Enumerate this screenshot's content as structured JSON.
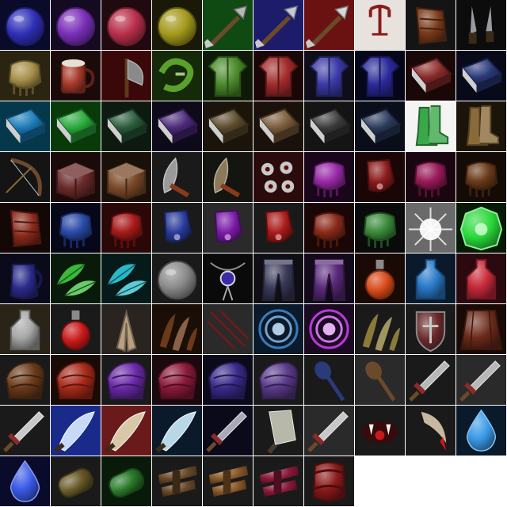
{
  "sheet": {
    "columns": 10,
    "icons": [
      {
        "icon": "blue-orb-icon",
        "shape": "orb",
        "color": "#2f2fb8",
        "bg": "#0a0a2a"
      },
      {
        "icon": "purple-orb-icon",
        "shape": "orb",
        "color": "#7a2fb8",
        "bg": "#140a22"
      },
      {
        "icon": "red-orb-icon",
        "shape": "orb",
        "color": "#b82f4a",
        "bg": "#200a10"
      },
      {
        "icon": "yellow-orb-icon",
        "shape": "orb",
        "color": "#a49a1c",
        "bg": "#1a1806"
      },
      {
        "icon": "poison-arrow-icon",
        "shape": "arrow",
        "color": "#b8b8b8",
        "bg": "#0e4a12"
      },
      {
        "icon": "frost-arrow-icon",
        "shape": "arrow",
        "color": "#c8c8d8",
        "bg": "#1c1c6a"
      },
      {
        "icon": "fire-arrow-icon",
        "shape": "arrow",
        "color": "#d8d8d8",
        "bg": "#6a1212"
      },
      {
        "icon": "grappling-hook-icon",
        "shape": "hook",
        "color": "#8a1a1a",
        "bg": "#e8e2dc"
      },
      {
        "icon": "leather-bracer-icon",
        "shape": "bracer",
        "color": "#7a3a1a",
        "bg": "#141414"
      },
      {
        "icon": "throwing-knives-icon",
        "shape": "blades",
        "color": "#9a9aa0",
        "bg": "#0c0c0c"
      },
      {
        "icon": "gold-gauntlet-icon",
        "shape": "gauntlet",
        "color": "#a8904a",
        "bg": "#2a2410"
      },
      {
        "icon": "ale-mug-icon",
        "shape": "mug",
        "color": "#a83a2a",
        "bg": "#1a0a0a"
      },
      {
        "icon": "war-axe-icon",
        "shape": "axe",
        "color": "#8a8a8a",
        "bg": "#3a0808"
      },
      {
        "icon": "green-sigil-icon",
        "shape": "sigil",
        "color": "#5aa02a",
        "bg": "#142a08"
      },
      {
        "icon": "green-tunic-icon",
        "shape": "tunic",
        "color": "#4a8a2a",
        "bg": "#0e1a08"
      },
      {
        "icon": "red-chest-armor-icon",
        "shape": "tunic",
        "color": "#a02a2a",
        "bg": "#1a0606"
      },
      {
        "icon": "plate-pauldron-icon",
        "shape": "tunic",
        "color": "#3a3aa8",
        "bg": "#0e0e1a"
      },
      {
        "icon": "arcane-robe-icon",
        "shape": "tunic",
        "color": "#2a2a9a",
        "bg": "#06061a"
      },
      {
        "icon": "red-tome-icon",
        "shape": "book",
        "color": "#8a2a2a",
        "bg": "#1a0808"
      },
      {
        "icon": "blue-tome-icon",
        "shape": "book",
        "color": "#2a3a7a",
        "bg": "#080a1a"
      },
      {
        "icon": "glowing-blue-tome-icon",
        "shape": "book",
        "color": "#1a7ab8",
        "bg": "#04384a"
      },
      {
        "icon": "glowing-green-tome-icon",
        "shape": "book",
        "color": "#2aa83a",
        "bg": "#083a0a"
      },
      {
        "icon": "green-spellbook-icon",
        "shape": "book",
        "color": "#2a5a3a",
        "bg": "#0c1a10"
      },
      {
        "icon": "purple-spellbook-icon",
        "shape": "book",
        "color": "#4a2a7a",
        "bg": "#0e0a1a"
      },
      {
        "icon": "olive-spellbook-icon",
        "shape": "book",
        "color": "#5a4a2a",
        "bg": "#1a140a"
      },
      {
        "icon": "wooden-book-icon",
        "shape": "book",
        "color": "#7a5a3a",
        "bg": "#1a120a"
      },
      {
        "icon": "black-book-icon",
        "shape": "book",
        "color": "#3a3a3a",
        "bg": "#141414"
      },
      {
        "icon": "navy-book-icon",
        "shape": "book",
        "color": "#2a3a5a",
        "bg": "#0a0e1a"
      },
      {
        "icon": "green-boots-icon",
        "shape": "boots",
        "color": "#3aa84a",
        "bg": "#f4f4f4"
      },
      {
        "icon": "leather-boots-icon",
        "shape": "boots",
        "color": "#8a6a3a",
        "bg": "#1a140a"
      },
      {
        "icon": "longbow-icon",
        "shape": "bow",
        "color": "#6a4a2a",
        "bg": "#141414"
      },
      {
        "icon": "red-chest-icon",
        "shape": "chest",
        "color": "#6a2a2a",
        "bg": "#1a0a0a"
      },
      {
        "icon": "wooden-chest-icon",
        "shape": "chest",
        "color": "#7a4a2a",
        "bg": "#1a100a"
      },
      {
        "icon": "curved-dagger-icon",
        "shape": "dagger",
        "color": "#9a9a9a",
        "bg": "#1a1a1a"
      },
      {
        "icon": "bronze-dagger-icon",
        "shape": "dagger",
        "color": "#8a7a5a",
        "bg": "#141410"
      },
      {
        "icon": "eyeballs-icon",
        "shape": "eyes",
        "color": "#c8c8c8",
        "bg": "#2a0a0a"
      },
      {
        "icon": "violet-gauntlet-icon",
        "shape": "gauntlet",
        "color": "#9a2aa8",
        "bg": "#1a061a"
      },
      {
        "icon": "crimson-glove-icon",
        "shape": "glove",
        "color": "#8a1a1a",
        "bg": "#1a0606"
      },
      {
        "icon": "magenta-gauntlet-icon",
        "shape": "gauntlet",
        "color": "#9a1a5a",
        "bg": "#1a0610"
      },
      {
        "icon": "brown-gauntlet-icon",
        "shape": "gauntlet",
        "color": "#6a3a1a",
        "bg": "#140a06"
      },
      {
        "icon": "ruby-bracer-icon",
        "shape": "bracer",
        "color": "#8a2a1a",
        "bg": "#140806"
      },
      {
        "icon": "sapphire-gauntlet-icon",
        "shape": "gauntlet",
        "color": "#2a4aa8",
        "bg": "#06081a"
      },
      {
        "icon": "red-striped-gauntlet-icon",
        "shape": "gauntlet",
        "color": "#a81a1a",
        "bg": "#2a0808"
      },
      {
        "icon": "steel-blue-glove-icon",
        "shape": "glove",
        "color": "#2a3a9a",
        "bg": "#1a1a1a"
      },
      {
        "icon": "violet-glove-icon",
        "shape": "glove",
        "color": "#7a1aa8",
        "bg": "#2a2a2a"
      },
      {
        "icon": "red-glove-icon",
        "shape": "glove",
        "color": "#a81a1a",
        "bg": "#1a1a1a"
      },
      {
        "icon": "flame-gauntlet-icon",
        "shape": "gauntlet",
        "color": "#8a2a1a",
        "bg": "#1a0606"
      },
      {
        "icon": "emerald-gauntlet-icon",
        "shape": "gauntlet",
        "color": "#3a8a3a",
        "bg": "#0a0a0a"
      },
      {
        "icon": "holy-light-icon",
        "shape": "burst",
        "color": "#f4f4f4",
        "bg": "#6a6a6a"
      },
      {
        "icon": "green-gem-icon",
        "shape": "gem",
        "color": "#2ad83a",
        "bg": "#061a06"
      },
      {
        "icon": "blue-pitcher-icon",
        "shape": "jug",
        "color": "#2a2a8a",
        "bg": "#0a0a1a"
      },
      {
        "icon": "green-leaves-icon",
        "shape": "leaves",
        "color": "#3ab83a",
        "bg": "#0a1a0a"
      },
      {
        "icon": "cyan-leaves-icon",
        "shape": "leaves",
        "color": "#2ab8c8",
        "bg": "#061a1a"
      },
      {
        "icon": "moon-stone-icon",
        "shape": "orb",
        "color": "#8a8a8a",
        "bg": "#1a1a1a"
      },
      {
        "icon": "amulet-icon",
        "shape": "amulet",
        "color": "#3a2aa8",
        "bg": "#0a0a0a"
      },
      {
        "icon": "dark-leggings-icon",
        "shape": "pants",
        "color": "#3a3a5a",
        "bg": "#0e0e14"
      },
      {
        "icon": "purple-leggings-icon",
        "shape": "pants",
        "color": "#5a2a7a",
        "bg": "#120a1a"
      },
      {
        "icon": "fire-potion-icon",
        "shape": "potion",
        "color": "#d84a1a",
        "bg": "#1a0a06"
      },
      {
        "icon": "blue-bottle-icon",
        "shape": "bottle",
        "color": "#2a7ac8",
        "bg": "#0a1a2a"
      },
      {
        "icon": "red-bottle-icon",
        "shape": "bottle",
        "color": "#c82a3a",
        "bg": "#2a0a0e"
      },
      {
        "icon": "silver-flask-icon",
        "shape": "bottle",
        "color": "#a8a8a8",
        "bg": "#2a2418"
      },
      {
        "icon": "red-potion-icon",
        "shape": "potion",
        "color": "#c81a1a",
        "bg": "#1a1a1a"
      },
      {
        "icon": "praying-hands-icon",
        "shape": "hands",
        "color": "#b8a080",
        "bg": "#2a2420"
      },
      {
        "icon": "claws-icon",
        "shape": "claw",
        "color": "#6a3a1a",
        "bg": "#1a0e06"
      },
      {
        "icon": "slash-marks-icon",
        "shape": "slash",
        "color": "#6a1a1a",
        "bg": "#2a2a2a"
      },
      {
        "icon": "vortex-icon",
        "shape": "vortex",
        "color": "#3a7ab8",
        "bg": "#0a1a2a"
      },
      {
        "icon": "purple-vortex-icon",
        "shape": "vortex",
        "color": "#b83ad8",
        "bg": "#1a0a22"
      },
      {
        "icon": "spiked-jaw-icon",
        "shape": "claw",
        "color": "#8a7a3a",
        "bg": "#1a1a1a"
      },
      {
        "icon": "shield-icon",
        "shape": "shield",
        "color": "#6a2a2a",
        "bg": "#1a1a1a"
      },
      {
        "icon": "leather-cloak-icon",
        "shape": "cloak",
        "color": "#6a2a1a",
        "bg": "#1a0a06"
      },
      {
        "icon": "leather-shoulder-icon",
        "shape": "shoulder",
        "color": "#6a3a1a",
        "bg": "#1a1a1a"
      },
      {
        "icon": "red-shoulder-icon",
        "shape": "shoulder",
        "color": "#a82a1a",
        "bg": "#1a0a06"
      },
      {
        "icon": "purple-shoulder-icon",
        "shape": "shoulder",
        "color": "#6a2aa8",
        "bg": "#1a1a1a"
      },
      {
        "icon": "crimson-shoulder-icon",
        "shape": "shoulder",
        "color": "#8a1a3a",
        "bg": "#1a0a0e"
      },
      {
        "icon": "indigo-shoulder-icon",
        "shape": "shoulder",
        "color": "#3a2a8a",
        "bg": "#0a0a1a"
      },
      {
        "icon": "violet-shoulder-icon",
        "shape": "shoulder",
        "color": "#5a3a8a",
        "bg": "#1a1a1a"
      },
      {
        "icon": "blue-spoon-icon",
        "shape": "spoon",
        "color": "#2a3a7a",
        "bg": "#1a1a1a"
      },
      {
        "icon": "wooden-spoon-icon",
        "shape": "spoon",
        "color": "#6a4a2a",
        "bg": "#2a2a2a"
      },
      {
        "icon": "steel-sword-icon",
        "shape": "sword",
        "color": "#b8b8b8",
        "bg": "#1a1a1a"
      },
      {
        "icon": "red-hilt-sword-icon",
        "shape": "sword",
        "color": "#b8b8b8",
        "bg": "#2a2a2a"
      },
      {
        "icon": "broadsword-icon",
        "shape": "sword",
        "color": "#c8c8c8",
        "bg": "#1a1a1a"
      },
      {
        "icon": "lightning-blade-icon",
        "shape": "blade",
        "color": "#c8d8f8",
        "bg": "#1a2a8a"
      },
      {
        "icon": "flame-blade-icon",
        "shape": "blade",
        "color": "#d8c8a8",
        "bg": "#6a1a1a"
      },
      {
        "icon": "ice-dagger-icon",
        "shape": "blade",
        "color": "#b8d8e8",
        "bg": "#0a1a2a"
      },
      {
        "icon": "ornate-sword-icon",
        "shape": "sword",
        "color": "#a8a8b8",
        "bg": "#0a0a1a"
      },
      {
        "icon": "cleaver-icon",
        "shape": "cleaver",
        "color": "#b8b8a8",
        "bg": "#1a1a1a"
      },
      {
        "icon": "short-sword-icon",
        "shape": "sword",
        "color": "#c8c8c8",
        "bg": "#2a2a2a"
      },
      {
        "icon": "fanged-mouth-icon",
        "shape": "fangs",
        "color": "#c81a1a",
        "bg": "#1a1a1a"
      },
      {
        "icon": "bloody-fang-icon",
        "shape": "fang",
        "color": "#c8b8a0",
        "bg": "#1a1a1a"
      },
      {
        "icon": "water-drop-icon",
        "shape": "drop",
        "color": "#3a9ae8",
        "bg": "#0a1a2a"
      },
      {
        "icon": "mana-drop-icon",
        "shape": "drop",
        "color": "#3a5ae8",
        "bg": "#0a0a2a"
      },
      {
        "icon": "wooden-scroll-icon",
        "shape": "scroll",
        "color": "#6a5a2a",
        "bg": "#1a1a1a"
      },
      {
        "icon": "green-scroll-icon",
        "shape": "scroll",
        "color": "#2a7a2a",
        "bg": "#0a1a0a"
      },
      {
        "icon": "belt-icon",
        "shape": "belt",
        "color": "#6a4a2a",
        "bg": "#1a1a1a"
      },
      {
        "icon": "quiver-icon",
        "shape": "belt",
        "color": "#8a5a2a",
        "bg": "#1a1a1a"
      },
      {
        "icon": "crimson-strap-icon",
        "shape": "belt",
        "color": "#8a1a3a",
        "bg": "#1a1a1a"
      },
      {
        "icon": "red-barrel-icon",
        "shape": "barrel",
        "color": "#8a1a1a",
        "bg": "#1a1a1a"
      }
    ]
  }
}
